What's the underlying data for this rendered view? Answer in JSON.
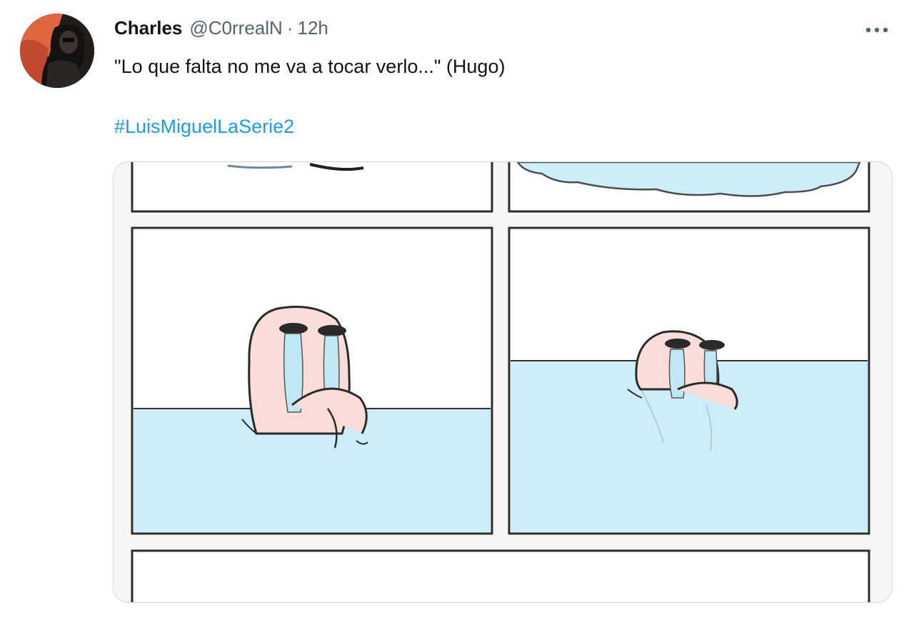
{
  "tweet": {
    "author_name": "Charles",
    "handle": "@C0rrealN",
    "separator": "·",
    "time": "12h",
    "text": "\"Lo que falta no me va a tocar verlo...\" (Hugo)",
    "hashtag": "#LuisMiguelLaSerie2",
    "more_icon": "more-horizontal-icon",
    "colors": {
      "link": "#1d9bf0",
      "secondary_text": "#536471",
      "primary_text": "#0f1419",
      "water": "#cdeef8"
    }
  }
}
